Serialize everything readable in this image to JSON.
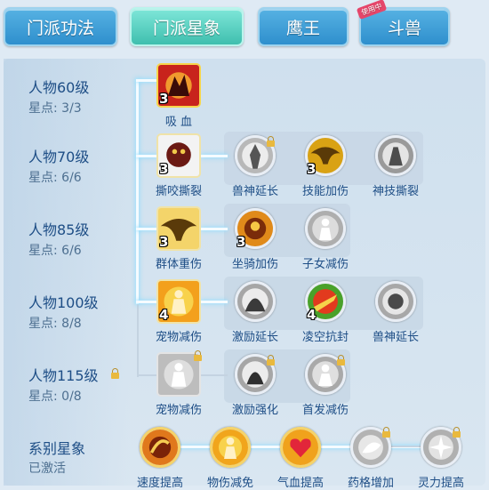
{
  "tabs": [
    {
      "label": "门派功法"
    },
    {
      "label": "门派星象"
    },
    {
      "label": "鹰王"
    },
    {
      "label": "斗兽"
    }
  ],
  "tab_badge": "使用中",
  "rows": [
    {
      "level": "人物60级",
      "stars": "星点: 3/3"
    },
    {
      "level": "人物70级",
      "stars": "星点: 6/6"
    },
    {
      "level": "人物85级",
      "stars": "星点: 6/6"
    },
    {
      "level": "人物100级",
      "stars": "星点: 8/8"
    },
    {
      "level": "人物115级",
      "stars": "星点: 0/8"
    }
  ],
  "skills": {
    "r0": {
      "main": {
        "label": "吸 血",
        "count": "3"
      }
    },
    "r1": {
      "main": {
        "label": "撕咬撕裂",
        "count": "3"
      },
      "a": {
        "label": "兽神延长"
      },
      "b": {
        "label": "技能加伤",
        "count": "3"
      },
      "c": {
        "label": "神技撕裂"
      }
    },
    "r2": {
      "main": {
        "label": "群体重伤",
        "count": "3"
      },
      "a": {
        "label": "坐骑加伤",
        "count": "3"
      },
      "b": {
        "label": "子女减伤"
      }
    },
    "r3": {
      "main": {
        "label": "宠物减伤",
        "count": "4"
      },
      "a": {
        "label": "激励延长"
      },
      "b": {
        "label": "凌空抗封",
        "count": "4"
      },
      "c": {
        "label": "兽神延长"
      }
    },
    "r4": {
      "main": {
        "label": "宠物减伤"
      },
      "a": {
        "label": "激励强化"
      },
      "b": {
        "label": "首发减伤"
      }
    }
  },
  "series": {
    "title": "系别星象",
    "status": "已激活",
    "items": [
      {
        "label": "速度提高"
      },
      {
        "label": "物伤减免"
      },
      {
        "label": "气血提高"
      },
      {
        "label": "药格增加"
      },
      {
        "label": "灵力提高"
      }
    ]
  }
}
